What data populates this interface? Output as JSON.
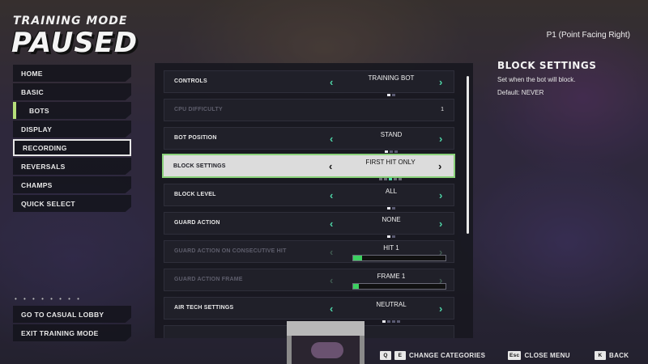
{
  "header": {
    "mode": "TRAINING MODE",
    "status": "PAUSED",
    "player": "P1 (Point Facing Right)"
  },
  "menu": {
    "items": [
      {
        "label": "HOME"
      },
      {
        "label": "BASIC"
      },
      {
        "label": "BOTS"
      },
      {
        "label": "DISPLAY"
      },
      {
        "label": "RECORDING"
      },
      {
        "label": "REVERSALS"
      },
      {
        "label": "CHAMPS"
      },
      {
        "label": "QUICK SELECT"
      }
    ],
    "dots": "• • • • • • • •",
    "bottom": [
      {
        "label": "GO TO CASUAL LOBBY"
      },
      {
        "label": "EXIT TRAINING MODE"
      }
    ]
  },
  "settings": {
    "controls": {
      "label": "CONTROLS",
      "value": "TRAINING BOT",
      "count": 2,
      "index": 0
    },
    "cpu_difficulty": {
      "label": "CPU DIFFICULTY",
      "value": "1"
    },
    "bot_position": {
      "label": "BOT POSITION",
      "value": "STAND",
      "count": 3,
      "index": 0
    },
    "block_settings": {
      "label": "BLOCK SETTINGS",
      "value": "FIRST HIT ONLY",
      "count": 5,
      "index": 2
    },
    "block_level": {
      "label": "BLOCK LEVEL",
      "value": "ALL",
      "count": 2,
      "index": 0
    },
    "guard_action": {
      "label": "GUARD ACTION",
      "value": "NONE",
      "count": 2,
      "index": 0
    },
    "guard_consec": {
      "label": "GUARD ACTION ON CONSECUTIVE HIT",
      "value": "HIT 1",
      "progress": 0.1
    },
    "guard_frame": {
      "label": "GUARD ACTION FRAME",
      "value": "FRAME 1",
      "progress": 0.06
    },
    "air_tech": {
      "label": "AIR TECH SETTINGS",
      "value": "NEUTRAL",
      "count": 4,
      "index": 0
    }
  },
  "info": {
    "title": "BLOCK SETTINGS",
    "description": "Set when the bot will block.",
    "default": "Default: NEVER"
  },
  "hints": [
    {
      "keys": [
        "Q",
        "E"
      ],
      "label": "CHANGE CATEGORIES"
    },
    {
      "keys": [
        "Esc"
      ],
      "label": "CLOSE MENU"
    },
    {
      "keys": [
        "K"
      ],
      "label": "BACK"
    }
  ],
  "icons": {
    "left_arrow": "chevron-left-icon",
    "right_arrow": "chevron-right-icon"
  },
  "colors": {
    "accent": "#4fd6a8",
    "selected_border": "#8ad27a",
    "progress": "#3cd060"
  }
}
